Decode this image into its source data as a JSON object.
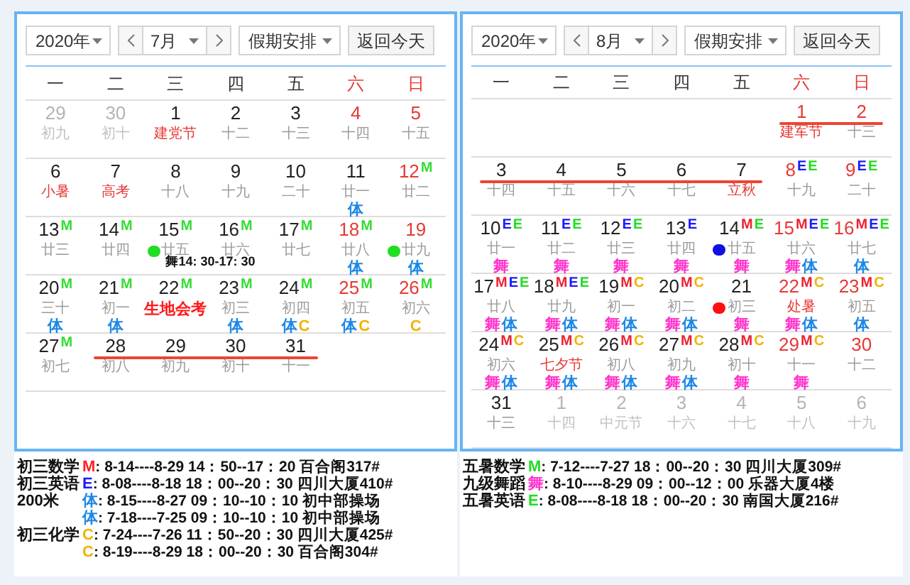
{
  "calendars": [
    {
      "controls": {
        "year": "2020年",
        "month": "7月",
        "mode": "假期安排",
        "today": "返回今天"
      },
      "weekdays": [
        {
          "label": "一",
          "weekend": false
        },
        {
          "label": "二",
          "weekend": false
        },
        {
          "label": "三",
          "weekend": false
        },
        {
          "label": "四",
          "weekend": false
        },
        {
          "label": "五",
          "weekend": false
        },
        {
          "label": "六",
          "weekend": true
        },
        {
          "label": "日",
          "weekend": true
        }
      ],
      "weeks": [
        {
          "days": [
            {
              "kind": "day",
              "day": "29",
              "lunar": "初九",
              "muted": true,
              "holiday": false,
              "festival": false,
              "struck": false
            },
            {
              "kind": "day",
              "day": "30",
              "lunar": "初十",
              "muted": true,
              "holiday": false,
              "festival": false,
              "struck": false
            },
            {
              "kind": "day",
              "day": "1",
              "lunar": "建党节",
              "muted": false,
              "holiday": false,
              "festival": true,
              "struck": false
            },
            {
              "kind": "day",
              "day": "2",
              "lunar": "十二",
              "muted": false,
              "holiday": false,
              "festival": false,
              "struck": false
            },
            {
              "kind": "day",
              "day": "3",
              "lunar": "十三",
              "muted": false,
              "holiday": false,
              "festival": false,
              "struck": false
            },
            {
              "kind": "day",
              "day": "4",
              "lunar": "十四",
              "muted": false,
              "holiday": true,
              "festival": false,
              "struck": false
            },
            {
              "kind": "day",
              "day": "5",
              "lunar": "十五",
              "muted": false,
              "holiday": true,
              "festival": false,
              "struck": false
            }
          ]
        },
        {
          "days": [
            {
              "kind": "day",
              "day": "6",
              "lunar": "小暑",
              "muted": false,
              "holiday": false,
              "festival": true,
              "struck": false
            },
            {
              "kind": "day",
              "day": "7",
              "lunar": "高考",
              "muted": false,
              "holiday": false,
              "festival": true,
              "struck": false
            },
            {
              "kind": "day",
              "day": "8",
              "lunar": "十八",
              "muted": false,
              "holiday": false,
              "festival": false,
              "struck": false
            },
            {
              "kind": "day",
              "day": "9",
              "lunar": "十九",
              "muted": false,
              "holiday": false,
              "festival": false,
              "struck": false
            },
            {
              "kind": "day",
              "day": "10",
              "lunar": "二十",
              "muted": false,
              "holiday": false,
              "festival": false,
              "struck": false
            },
            {
              "kind": "day",
              "day": "11",
              "lunar": "廿一",
              "muted": false,
              "holiday": false,
              "festival": false,
              "struck": false,
              "tags": [
                {
                  "text": "体",
                  "color": "#1e88e5"
                }
              ]
            },
            {
              "kind": "day",
              "day": "12",
              "lunar": "廿二",
              "muted": false,
              "holiday": true,
              "festival": false,
              "struck": false,
              "marks": [
                {
                  "text": "M",
                  "color": "#33dd33"
                }
              ]
            }
          ]
        },
        {
          "note": "舞14: 30-17: 30",
          "days": [
            {
              "kind": "day",
              "day": "13",
              "lunar": "廿三",
              "muted": false,
              "holiday": false,
              "festival": false,
              "struck": false,
              "marks": [
                {
                  "text": "M",
                  "color": "#33dd33"
                }
              ]
            },
            {
              "kind": "day",
              "day": "14",
              "lunar": "廿四",
              "muted": false,
              "holiday": false,
              "festival": false,
              "struck": false,
              "marks": [
                {
                  "text": "M",
                  "color": "#33dd33"
                }
              ]
            },
            {
              "kind": "day",
              "day": "15",
              "lunar": "廿五",
              "muted": false,
              "holiday": false,
              "festival": false,
              "struck": false,
              "dot": {
                "color": "#22dd22"
              },
              "marks": [
                {
                  "text": "M",
                  "color": "#33dd33"
                }
              ]
            },
            {
              "kind": "day",
              "day": "16",
              "lunar": "廿六",
              "muted": false,
              "holiday": false,
              "festival": false,
              "struck": false,
              "marks": [
                {
                  "text": "M",
                  "color": "#33dd33"
                }
              ]
            },
            {
              "kind": "day",
              "day": "17",
              "lunar": "廿七",
              "muted": false,
              "holiday": false,
              "festival": false,
              "struck": false,
              "marks": [
                {
                  "text": "M",
                  "color": "#33dd33"
                }
              ]
            },
            {
              "kind": "day",
              "day": "18",
              "lunar": "廿八",
              "muted": false,
              "holiday": true,
              "festival": false,
              "struck": false,
              "marks": [
                {
                  "text": "M",
                  "color": "#33dd33"
                }
              ],
              "tags": [
                {
                  "text": "体",
                  "color": "#1e88e5"
                }
              ]
            },
            {
              "kind": "day",
              "day": "19",
              "lunar": "廿九",
              "muted": false,
              "holiday": true,
              "festival": false,
              "struck": false,
              "dot": {
                "color": "#22dd22"
              },
              "tags": [
                {
                  "text": "体",
                  "color": "#1e88e5"
                }
              ]
            }
          ]
        },
        {
          "days": [
            {
              "kind": "day",
              "day": "20",
              "lunar": "三十",
              "muted": false,
              "holiday": false,
              "festival": false,
              "struck": false,
              "marks": [
                {
                  "text": "M",
                  "color": "#33dd33"
                }
              ],
              "tags": [
                {
                  "text": "体",
                  "color": "#1e88e5"
                }
              ]
            },
            {
              "kind": "day",
              "day": "21",
              "lunar": "初一",
              "muted": false,
              "holiday": false,
              "festival": false,
              "struck": false,
              "marks": [
                {
                  "text": "M",
                  "color": "#33dd33"
                }
              ],
              "tags": [
                {
                  "text": "体",
                  "color": "#1e88e5"
                }
              ]
            },
            {
              "kind": "exam",
              "day": "22",
              "lunar": "生地会考",
              "muted": false,
              "holiday": false,
              "festival": true,
              "struck": false,
              "marks": [
                {
                  "text": "M",
                  "color": "#33dd33"
                }
              ]
            },
            {
              "kind": "day",
              "day": "23",
              "lunar": "初三",
              "muted": false,
              "holiday": false,
              "festival": false,
              "struck": false,
              "marks": [
                {
                  "text": "M",
                  "color": "#33dd33"
                }
              ],
              "tags": [
                {
                  "text": "体",
                  "color": "#1e88e5"
                }
              ]
            },
            {
              "kind": "day",
              "day": "24",
              "lunar": "初四",
              "muted": false,
              "holiday": false,
              "festival": false,
              "struck": false,
              "marks": [
                {
                  "text": "M",
                  "color": "#33dd33"
                }
              ],
              "tags": [
                {
                  "text": "体",
                  "color": "#1e88e5"
                },
                {
                  "text": "C",
                  "color": "#f0b400"
                }
              ]
            },
            {
              "kind": "day",
              "day": "25",
              "lunar": "初五",
              "muted": false,
              "holiday": true,
              "festival": false,
              "struck": false,
              "marks": [
                {
                  "text": "M",
                  "color": "#33dd33"
                }
              ],
              "tags": [
                {
                  "text": "体",
                  "color": "#1e88e5"
                },
                {
                  "text": "C",
                  "color": "#f0b400"
                }
              ]
            },
            {
              "kind": "day",
              "day": "26",
              "lunar": "初六",
              "muted": false,
              "holiday": true,
              "festival": false,
              "struck": false,
              "marks": [
                {
                  "text": "M",
                  "color": "#33dd33"
                }
              ],
              "tags": [
                {
                  "text": "C",
                  "color": "#f0b400"
                }
              ]
            }
          ]
        },
        {
          "days": [
            {
              "kind": "day",
              "day": "27",
              "lunar": "初七",
              "muted": false,
              "holiday": false,
              "festival": false,
              "struck": false,
              "marks": [
                {
                  "text": "M",
                  "color": "#33dd33"
                }
              ]
            },
            {
              "kind": "day",
              "day": "28",
              "lunar": "初八",
              "muted": false,
              "holiday": false,
              "festival": false,
              "struck": true
            },
            {
              "kind": "day",
              "day": "29",
              "lunar": "初九",
              "muted": false,
              "holiday": false,
              "festival": false,
              "struck": true
            },
            {
              "kind": "day",
              "day": "30",
              "lunar": "初十",
              "muted": false,
              "holiday": false,
              "festival": false,
              "struck": true
            },
            {
              "kind": "day",
              "day": "31",
              "lunar": "十一",
              "muted": false,
              "holiday": false,
              "festival": false,
              "struck": true
            }
          ]
        }
      ],
      "legend": [
        {
          "label": "初三数学",
          "code": "M",
          "color": "#ff2222",
          "text": ": 8-14----8-29 14：50--17：20 百合阁317#"
        },
        {
          "label": "初三英语",
          "code": "E",
          "color": "#1a1aff",
          "text": ": 8-08----8-18 18：00--20：30 四川大厦410#"
        },
        {
          "label": "200米",
          "code": "体",
          "color": "#1e88e5",
          "text": ": 8-15----8-27 09：10--10：10 初中部操场"
        },
        {
          "code": "体",
          "color": "#1e88e5",
          "text": ": 7-18----7-25 09：10--10：10 初中部操场"
        },
        {
          "label": "初三化学",
          "code": "C",
          "color": "#f0b400",
          "text": ": 7-24----7-26 11：50--20：30 四川大厦425#"
        },
        {
          "code": "C",
          "color": "#f0b400",
          "text": ": 8-19----8-29 18：00--20：30 百合阁304#"
        }
      ]
    },
    {
      "controls": {
        "year": "2020年",
        "month": "8月",
        "mode": "假期安排",
        "today": "返回今天"
      },
      "weekdays": [
        {
          "label": "一",
          "weekend": false
        },
        {
          "label": "二",
          "weekend": false
        },
        {
          "label": "三",
          "weekend": false
        },
        {
          "label": "四",
          "weekend": false
        },
        {
          "label": "五",
          "weekend": false
        },
        {
          "label": "六",
          "weekend": true
        },
        {
          "label": "日",
          "weekend": true
        }
      ],
      "weeks": [
        {
          "days": [
            {
              "kind": "empty"
            },
            {
              "kind": "empty"
            },
            {
              "kind": "empty"
            },
            {
              "kind": "empty"
            },
            {
              "kind": "empty"
            },
            {
              "kind": "day",
              "day": "1",
              "lunar": "建军节",
              "muted": false,
              "holiday": true,
              "festival": true,
              "struck": true
            },
            {
              "kind": "day",
              "day": "2",
              "lunar": "十三",
              "muted": false,
              "holiday": true,
              "festival": false,
              "struck": true
            }
          ]
        },
        {
          "days": [
            {
              "kind": "day",
              "day": "3",
              "lunar": "十四",
              "muted": false,
              "holiday": false,
              "festival": false,
              "struck": true
            },
            {
              "kind": "day",
              "day": "4",
              "lunar": "十五",
              "muted": false,
              "holiday": false,
              "festival": false,
              "struck": true
            },
            {
              "kind": "day",
              "day": "5",
              "lunar": "十六",
              "muted": false,
              "holiday": false,
              "festival": false,
              "struck": true
            },
            {
              "kind": "day",
              "day": "6",
              "lunar": "十七",
              "muted": false,
              "holiday": false,
              "festival": false,
              "struck": true
            },
            {
              "kind": "day",
              "day": "7",
              "lunar": "立秋",
              "muted": false,
              "holiday": false,
              "festival": true,
              "struck": true
            },
            {
              "kind": "day",
              "day": "8",
              "lunar": "十九",
              "muted": false,
              "holiday": true,
              "festival": false,
              "struck": false,
              "marks": [
                {
                  "text": "E",
                  "color": "#1a1aff"
                },
                {
                  "text": "E",
                  "color": "#22dd22"
                }
              ]
            },
            {
              "kind": "day",
              "day": "9",
              "lunar": "二十",
              "muted": false,
              "holiday": true,
              "festival": false,
              "struck": false,
              "marks": [
                {
                  "text": "E",
                  "color": "#1a1aff"
                },
                {
                  "text": "E",
                  "color": "#22dd22"
                }
              ]
            }
          ]
        },
        {
          "days": [
            {
              "kind": "day",
              "day": "10",
              "lunar": "廿一",
              "muted": false,
              "holiday": false,
              "festival": false,
              "struck": false,
              "marks": [
                {
                  "text": "E",
                  "color": "#1a1aff"
                },
                {
                  "text": "E",
                  "color": "#22dd22"
                }
              ],
              "tags": [
                {
                  "text": "舞",
                  "color": "#ff33cc"
                }
              ]
            },
            {
              "kind": "day",
              "day": "11",
              "lunar": "廿二",
              "muted": false,
              "holiday": false,
              "festival": false,
              "struck": false,
              "marks": [
                {
                  "text": "E",
                  "color": "#1a1aff"
                },
                {
                  "text": "E",
                  "color": "#22dd22"
                }
              ],
              "tags": [
                {
                  "text": "舞",
                  "color": "#ff33cc"
                }
              ]
            },
            {
              "kind": "day",
              "day": "12",
              "lunar": "廿三",
              "muted": false,
              "holiday": false,
              "festival": false,
              "struck": false,
              "marks": [
                {
                  "text": "E",
                  "color": "#1a1aff"
                },
                {
                  "text": "E",
                  "color": "#22dd22"
                }
              ],
              "tags": [
                {
                  "text": "舞",
                  "color": "#ff33cc"
                }
              ]
            },
            {
              "kind": "day",
              "day": "13",
              "lunar": "廿四",
              "muted": false,
              "holiday": false,
              "festival": false,
              "struck": false,
              "marks": [
                {
                  "text": "E",
                  "color": "#1a1aff"
                }
              ],
              "tags": [
                {
                  "text": "舞",
                  "color": "#ff33cc"
                }
              ]
            },
            {
              "kind": "day",
              "day": "14",
              "lunar": "廿五",
              "muted": false,
              "holiday": false,
              "festival": false,
              "struck": false,
              "dot": {
                "color": "#1010e0"
              },
              "marks": [
                {
                  "text": "M",
                  "color": "#ee2233"
                },
                {
                  "text": "E",
                  "color": "#22dd22"
                }
              ],
              "tags": [
                {
                  "text": "舞",
                  "color": "#ff33cc"
                }
              ]
            },
            {
              "kind": "day",
              "day": "15",
              "lunar": "廿六",
              "muted": false,
              "holiday": true,
              "festival": false,
              "struck": false,
              "marks": [
                {
                  "text": "M",
                  "color": "#ee2233"
                },
                {
                  "text": "E",
                  "color": "#1a1aff"
                },
                {
                  "text": "E",
                  "color": "#22dd22"
                }
              ],
              "tags": [
                {
                  "text": "舞",
                  "color": "#ff33cc"
                },
                {
                  "text": "体",
                  "color": "#1e88e5"
                }
              ]
            },
            {
              "kind": "day",
              "day": "16",
              "lunar": "廿七",
              "muted": false,
              "holiday": true,
              "festival": false,
              "struck": false,
              "marks": [
                {
                  "text": "M",
                  "color": "#ee2233"
                },
                {
                  "text": "E",
                  "color": "#1a1aff"
                },
                {
                  "text": "E",
                  "color": "#22dd22"
                }
              ],
              "tags": [
                {
                  "text": "体",
                  "color": "#1e88e5"
                }
              ]
            }
          ]
        },
        {
          "days": [
            {
              "kind": "day",
              "day": "17",
              "lunar": "廿八",
              "muted": false,
              "holiday": false,
              "festival": false,
              "struck": false,
              "marks": [
                {
                  "text": "M",
                  "color": "#ee2233"
                },
                {
                  "text": "E",
                  "color": "#1a1aff"
                },
                {
                  "text": "E",
                  "color": "#22dd22"
                }
              ],
              "tags": [
                {
                  "text": "舞",
                  "color": "#ff33cc"
                },
                {
                  "text": "体",
                  "color": "#1e88e5"
                }
              ]
            },
            {
              "kind": "day",
              "day": "18",
              "lunar": "廿九",
              "muted": false,
              "holiday": false,
              "festival": false,
              "struck": false,
              "marks": [
                {
                  "text": "M",
                  "color": "#ee2233"
                },
                {
                  "text": "E",
                  "color": "#1a1aff"
                },
                {
                  "text": "E",
                  "color": "#22dd22"
                }
              ],
              "tags": [
                {
                  "text": "舞",
                  "color": "#ff33cc"
                },
                {
                  "text": "体",
                  "color": "#1e88e5"
                }
              ]
            },
            {
              "kind": "day",
              "day": "19",
              "lunar": "初一",
              "muted": false,
              "holiday": false,
              "festival": false,
              "struck": false,
              "marks": [
                {
                  "text": "M",
                  "color": "#ee2233"
                },
                {
                  "text": "C",
                  "color": "#f0b400"
                }
              ],
              "tags": [
                {
                  "text": "舞",
                  "color": "#ff33cc"
                },
                {
                  "text": "体",
                  "color": "#1e88e5"
                }
              ]
            },
            {
              "kind": "day",
              "day": "20",
              "lunar": "初二",
              "muted": false,
              "holiday": false,
              "festival": false,
              "struck": false,
              "marks": [
                {
                  "text": "M",
                  "color": "#ee2233"
                },
                {
                  "text": "C",
                  "color": "#f0b400"
                }
              ],
              "tags": [
                {
                  "text": "舞",
                  "color": "#ff33cc"
                },
                {
                  "text": "体",
                  "color": "#1e88e5"
                }
              ]
            },
            {
              "kind": "day",
              "day": "21",
              "lunar": "初三",
              "muted": false,
              "holiday": false,
              "festival": false,
              "struck": false,
              "dot": {
                "color": "#ff1010"
              },
              "tags": [
                {
                  "text": "舞",
                  "color": "#ff33cc"
                }
              ]
            },
            {
              "kind": "day",
              "day": "22",
              "lunar": "处暑",
              "muted": false,
              "holiday": true,
              "festival": true,
              "struck": false,
              "marks": [
                {
                  "text": "M",
                  "color": "#ee2233"
                },
                {
                  "text": "C",
                  "color": "#f0b400"
                }
              ],
              "tags": [
                {
                  "text": "舞",
                  "color": "#ff33cc"
                },
                {
                  "text": "体",
                  "color": "#1e88e5"
                }
              ]
            },
            {
              "kind": "day",
              "day": "23",
              "lunar": "初五",
              "muted": false,
              "holiday": true,
              "festival": false,
              "struck": false,
              "marks": [
                {
                  "text": "M",
                  "color": "#ee2233"
                },
                {
                  "text": "C",
                  "color": "#f0b400"
                }
              ],
              "tags": [
                {
                  "text": "体",
                  "color": "#1e88e5"
                }
              ]
            }
          ]
        },
        {
          "days": [
            {
              "kind": "day",
              "day": "24",
              "lunar": "初六",
              "muted": false,
              "holiday": false,
              "festival": false,
              "struck": false,
              "marks": [
                {
                  "text": "M",
                  "color": "#ee2233"
                },
                {
                  "text": "C",
                  "color": "#f0b400"
                }
              ],
              "tags": [
                {
                  "text": "舞",
                  "color": "#ff33cc"
                },
                {
                  "text": "体",
                  "color": "#1e88e5"
                }
              ]
            },
            {
              "kind": "day",
              "day": "25",
              "lunar": "七夕节",
              "muted": false,
              "holiday": false,
              "festival": true,
              "struck": false,
              "marks": [
                {
                  "text": "M",
                  "color": "#ee2233"
                },
                {
                  "text": "C",
                  "color": "#f0b400"
                }
              ],
              "tags": [
                {
                  "text": "舞",
                  "color": "#ff33cc"
                },
                {
                  "text": "体",
                  "color": "#1e88e5"
                }
              ]
            },
            {
              "kind": "day",
              "day": "26",
              "lunar": "初八",
              "muted": false,
              "holiday": false,
              "festival": false,
              "struck": false,
              "marks": [
                {
                  "text": "M",
                  "color": "#ee2233"
                },
                {
                  "text": "C",
                  "color": "#f0b400"
                }
              ],
              "tags": [
                {
                  "text": "舞",
                  "color": "#ff33cc"
                },
                {
                  "text": "体",
                  "color": "#1e88e5"
                }
              ]
            },
            {
              "kind": "day",
              "day": "27",
              "lunar": "初九",
              "muted": false,
              "holiday": false,
              "festival": false,
              "struck": false,
              "marks": [
                {
                  "text": "M",
                  "color": "#ee2233"
                },
                {
                  "text": "C",
                  "color": "#f0b400"
                }
              ],
              "tags": [
                {
                  "text": "舞",
                  "color": "#ff33cc"
                },
                {
                  "text": "体",
                  "color": "#1e88e5"
                }
              ]
            },
            {
              "kind": "day",
              "day": "28",
              "lunar": "初十",
              "muted": false,
              "holiday": false,
              "festival": false,
              "struck": false,
              "marks": [
                {
                  "text": "M",
                  "color": "#ee2233"
                },
                {
                  "text": "C",
                  "color": "#f0b400"
                }
              ],
              "tags": [
                {
                  "text": "舞",
                  "color": "#ff33cc"
                }
              ]
            },
            {
              "kind": "day",
              "day": "29",
              "lunar": "十一",
              "muted": false,
              "holiday": true,
              "festival": false,
              "struck": false,
              "marks": [
                {
                  "text": "M",
                  "color": "#ee2233"
                },
                {
                  "text": "C",
                  "color": "#f0b400"
                }
              ],
              "tags": [
                {
                  "text": "舞",
                  "color": "#ff33cc"
                }
              ]
            },
            {
              "kind": "day",
              "day": "30",
              "lunar": "十二",
              "muted": false,
              "holiday": true,
              "festival": false,
              "struck": false
            }
          ]
        },
        {
          "days": [
            {
              "kind": "day",
              "day": "31",
              "lunar": "十三",
              "muted": false,
              "holiday": false,
              "festival": false,
              "struck": false
            },
            {
              "kind": "day",
              "day": "1",
              "lunar": "十四",
              "muted": true,
              "holiday": false,
              "festival": false,
              "struck": false
            },
            {
              "kind": "day",
              "day": "2",
              "lunar": "中元节",
              "muted": true,
              "holiday": false,
              "festival": false,
              "struck": false
            },
            {
              "kind": "day",
              "day": "3",
              "lunar": "十六",
              "muted": true,
              "holiday": false,
              "festival": false,
              "struck": false
            },
            {
              "kind": "day",
              "day": "4",
              "lunar": "十七",
              "muted": true,
              "holiday": false,
              "festival": false,
              "struck": false
            },
            {
              "kind": "day",
              "day": "5",
              "lunar": "十八",
              "muted": true,
              "holiday": false,
              "festival": false,
              "struck": false
            },
            {
              "kind": "day",
              "day": "6",
              "lunar": "十九",
              "muted": true,
              "holiday": false,
              "festival": false,
              "struck": false
            }
          ]
        }
      ],
      "legend": [
        {
          "label": "五暑数学",
          "code": "M",
          "color": "#22dd22",
          "text": ": 7-12----7-27 18：00--20：30 四川大厦309#"
        },
        {
          "label": "九级舞蹈",
          "code": "舞",
          "color": "#ff33cc",
          "text": ": 8-10----8-29 09：00--12：00 乐器大厦4楼"
        },
        {
          "label": "五暑英语",
          "code": "E",
          "color": "#22dd22",
          "text": ": 8-08----8-18 18：00--20：30 南国大厦216#"
        }
      ]
    }
  ]
}
